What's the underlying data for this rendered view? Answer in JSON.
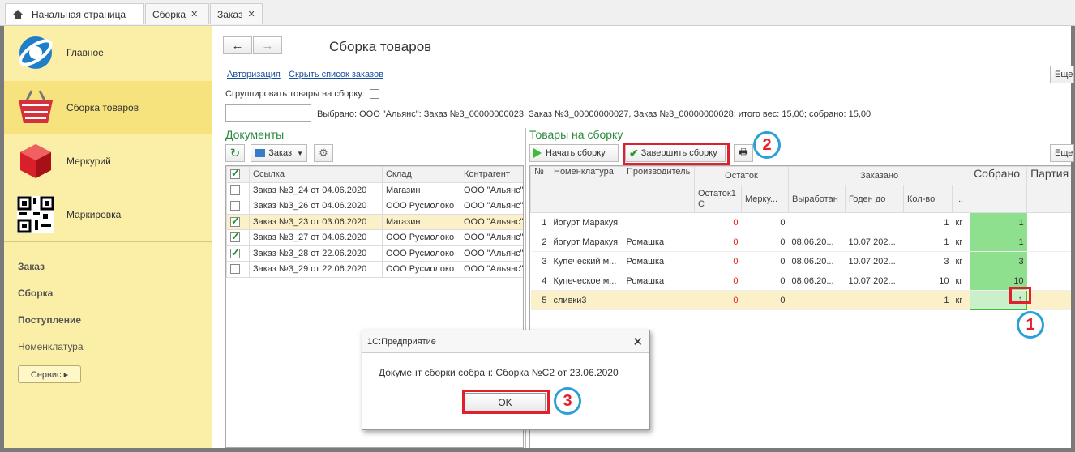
{
  "tabs": [
    {
      "label": "Начальная страница"
    },
    {
      "label": "Сборка"
    },
    {
      "label": "Заказ"
    }
  ],
  "sidebar": {
    "items": [
      {
        "label": "Главное"
      },
      {
        "label": "Сборка товаров"
      },
      {
        "label": "Меркурий"
      },
      {
        "label": "Маркировка"
      }
    ],
    "links": [
      "Заказ",
      "Сборка",
      "Поступление",
      "Номенклатура"
    ],
    "service_button": "Сервис ▸"
  },
  "main": {
    "title": "Сборка товаров",
    "links": [
      "Авторизация",
      "Скрыть список заказов"
    ],
    "more_label": "Еще",
    "group_label": "Сгруппировать товары на сборку:",
    "selected_text": "Выбрано: ООО \"Альянс\": Заказ №3_00000000023, Заказ №3_00000000027, Заказ №3_00000000028; итого вес: 15,00; собрано: 15,00"
  },
  "documents": {
    "title": "Документы",
    "order_button": "Заказ",
    "columns": [
      "Ссылка",
      "Склад",
      "Контрагент"
    ],
    "rows": [
      {
        "checked": false,
        "ref": "Заказ №3_24 от 04.06.2020",
        "store": "Магазин",
        "agent": "ООО \"Альянс\""
      },
      {
        "checked": false,
        "ref": "Заказ №3_26 от 04.06.2020",
        "store": "ООО Русмолоко",
        "agent": "ООО \"Альянс\""
      },
      {
        "checked": true,
        "ref": "Заказ №3_23 от 03.06.2020",
        "store": "Магазин",
        "agent": "ООО \"Альянс\""
      },
      {
        "checked": true,
        "ref": "Заказ №3_27 от 04.06.2020",
        "store": "ООО Русмолоко",
        "agent": "ООО \"Альянс\""
      },
      {
        "checked": true,
        "ref": "Заказ №3_28 от 22.06.2020",
        "store": "ООО Русмолоко",
        "agent": "ООО \"Альянс\""
      },
      {
        "checked": false,
        "ref": "Заказ №3_29 от 22.06.2020",
        "store": "ООО Русмолоко",
        "agent": "ООО \"Альянс\""
      }
    ]
  },
  "goods": {
    "title": "Товары на сборку",
    "start_button": "Начать сборку",
    "finish_button": "Завершить сборку",
    "headers": {
      "num": "№",
      "nom": "Номенклатура",
      "maker": "Производитель",
      "rest": "Остаток",
      "ordered": "Заказано",
      "collected": "Собрано",
      "party": "Партия",
      "rest1c": "Остаток1 С",
      "merc": "Мерку...",
      "made": "Выработан",
      "until": "Годен до",
      "qty": "Кол-во",
      "dots": "..."
    },
    "rows": [
      {
        "n": "1",
        "nom": "йогурт Маракуя",
        "maker": "",
        "rest1c": "0",
        "merc": "0",
        "made": "",
        "until": "",
        "qty": "1",
        "unit": "кг",
        "collected": "1"
      },
      {
        "n": "2",
        "nom": "йогурт Маракуя",
        "maker": "Ромашка",
        "rest1c": "0",
        "merc": "0",
        "made": "08.06.20...",
        "until": "10.07.202...",
        "qty": "1",
        "unit": "кг",
        "collected": "1"
      },
      {
        "n": "3",
        "nom": "Купеческий м...",
        "maker": "Ромашка",
        "rest1c": "0",
        "merc": "0",
        "made": "08.06.20...",
        "until": "10.07.202...",
        "qty": "3",
        "unit": "кг",
        "collected": "3"
      },
      {
        "n": "4",
        "nom": "Купеческое м...",
        "maker": "Ромашка",
        "rest1c": "0",
        "merc": "0",
        "made": "08.06.20...",
        "until": "10.07.202...",
        "qty": "10",
        "unit": "кг",
        "collected": "10"
      },
      {
        "n": "5",
        "nom": "сливки3",
        "maker": "",
        "rest1c": "0",
        "merc": "0",
        "made": "",
        "until": "",
        "qty": "1",
        "unit": "кг",
        "collected": "1"
      }
    ]
  },
  "dialog": {
    "title": "1С:Предприятие",
    "message": "Документ сборки собран: Сборка №С2 от 23.06.2020",
    "ok": "OK"
  },
  "badges": [
    "1",
    "2",
    "3"
  ],
  "colors": {
    "sidebar": "#fbeea6",
    "accent_green": "#2b8a3e",
    "highlight_red": "#e0202c",
    "badge_border": "#2a9fd8"
  }
}
